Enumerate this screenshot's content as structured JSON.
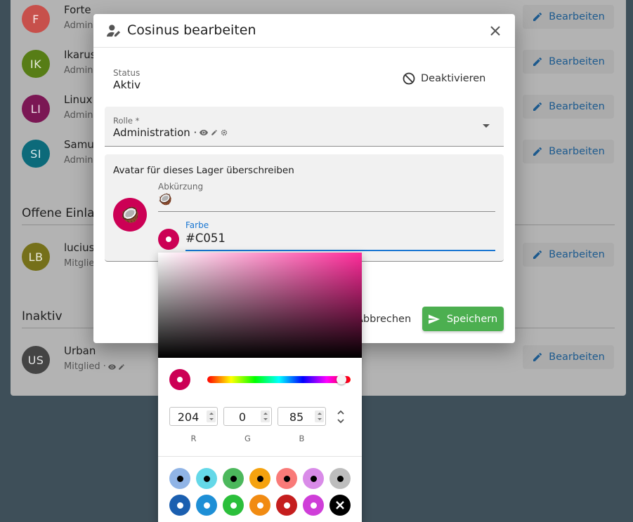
{
  "background": {
    "members": [
      {
        "initials": "F",
        "name": "Forte",
        "role": "Admin",
        "color": "#c7504b"
      },
      {
        "initials": "IK",
        "name": "Ikarus",
        "role": "Admin",
        "color": "#577d16"
      },
      {
        "initials": "LI",
        "name": "Linux",
        "role": "Admin",
        "color": "#7b1754"
      },
      {
        "initials": "SI",
        "name": "Samu",
        "role": "Admin",
        "color": "#0c6a7a"
      }
    ],
    "invites_title": "Offene Einla",
    "invites": [
      {
        "initials": "LB",
        "name": "lucius",
        "role": "Mitglie",
        "color": "#75701a"
      }
    ],
    "inactive_title": "Inaktiv",
    "inactive": [
      {
        "initials": "US",
        "name": "Urban",
        "role": "Mitglied ·",
        "color": "#444444"
      }
    ],
    "edit_label": "Bearbeiten"
  },
  "dialog": {
    "title": "Cosinus bearbeiten",
    "status_label": "Status",
    "status_value": "Aktiv",
    "deactivate_label": "Deaktivieren",
    "role_label": "Rolle *",
    "role_value": "Administration ·",
    "avatar_title": "Avatar für dieses Lager überschreiben",
    "avatar_emoji": "🥥",
    "abbr_label": "Abkürzung",
    "abbr_value": "🥥",
    "color_label": "Farbe",
    "color_value": "#C051",
    "color_hex": "#cc0055",
    "cancel_label": "Abbrechen",
    "save_label": "Speichern"
  },
  "picker": {
    "r": "204",
    "g": "0",
    "b": "85",
    "r_label": "R",
    "g_label": "G",
    "b_label": "B",
    "swatches_row1": [
      "#90b4e6",
      "#64d8e8",
      "#4cb85c",
      "#f5a20e",
      "#f97a78",
      "#d98be8",
      "#bdbdbd"
    ],
    "swatches_row2": [
      "#1b5fb0",
      "#1e8fd6",
      "#2bbf3b",
      "#f18b12",
      "#c51e1e",
      "#cf3ed8",
      "#000000"
    ]
  }
}
